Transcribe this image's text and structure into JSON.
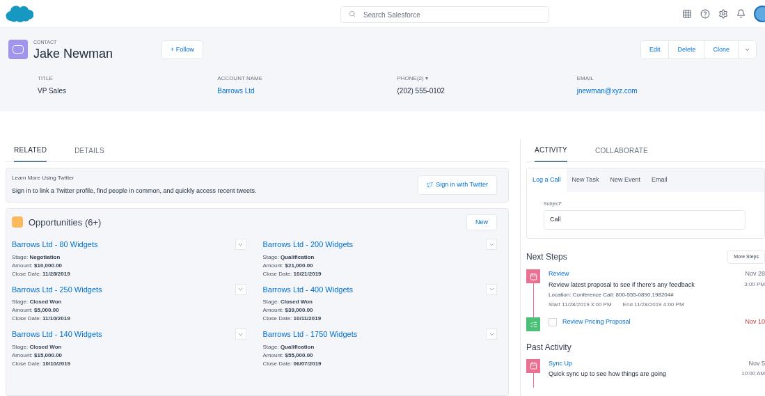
{
  "header": {
    "search": {
      "placeholder": "Search Salesforce"
    }
  },
  "record": {
    "type_label": "CONTACT",
    "name": "Jake Newman",
    "follow": "+ Follow",
    "actions": [
      "Edit",
      "Delete",
      "Clone"
    ],
    "fields": [
      {
        "label": "TITLE",
        "value": "VP Sales",
        "kind": "text"
      },
      {
        "label": "ACCOUNT NAME",
        "value": "Barrows Ltd",
        "kind": "link"
      },
      {
        "label": "PHONE(2) ▾",
        "value": "(202) 555-0102",
        "kind": "text"
      },
      {
        "label": "EMAIL",
        "value": "jnewman@xyz.com",
        "kind": "link"
      }
    ]
  },
  "left_tabs": [
    {
      "label": "RELATED",
      "selected": true
    },
    {
      "label": "DETAILS",
      "selected": false
    }
  ],
  "twitter": {
    "title": "Learn More Using Twitter",
    "text": "Sign in to link a Twitter profile, find people in common, and quickly access recent tweets.",
    "button": "Sign in with Twitter"
  },
  "opportunities": {
    "title": "Opportunities (6+)",
    "new_button": "New",
    "items": [
      {
        "name": "Barrows Ltd - 80 Widgets",
        "stage_label": "Stage:",
        "stage": "Negotiation",
        "amount_label": "Amount:",
        "amount": "$10,000.00",
        "close_label": "Close Date:",
        "close": "11/28/2019"
      },
      {
        "name": "Barrows Ltd - 200 Widgets",
        "stage_label": "Stage:",
        "stage": "Qualification",
        "amount_label": "Amount:",
        "amount": "$21,000.00",
        "close_label": "Close Date:",
        "close": "10/21/2019"
      },
      {
        "name": "Barrows Ltd - 250 Widgets",
        "stage_label": "Stage:",
        "stage": "Closed Won",
        "amount_label": "Amount:",
        "amount": "$5,000.00",
        "close_label": "Close Date:",
        "close": "11/10/2019"
      },
      {
        "name": "Barrows Ltd - 400 Widgets",
        "stage_label": "Stage:",
        "stage": "Closed Won",
        "amount_label": "Amount:",
        "amount": "$39,000.00",
        "close_label": "Close Date:",
        "close": "10/11/2019"
      },
      {
        "name": "Barrows Ltd - 140 Widgets",
        "stage_label": "Stage:",
        "stage": "Closed Won",
        "amount_label": "Amount:",
        "amount": "$15,000.00",
        "close_label": "Close Date:",
        "close": "10/10/2019"
      },
      {
        "name": "Barrows Ltd - 1750 Widgets",
        "stage_label": "Stage:",
        "stage": "Qualification",
        "amount_label": "Amount:",
        "amount": "$55,000.00",
        "close_label": "Close Date:",
        "close": "06/07/2019"
      }
    ]
  },
  "right_tabs": [
    {
      "label": "ACTIVITY",
      "selected": true
    },
    {
      "label": "COLLABORATE",
      "selected": false
    }
  ],
  "composer": {
    "tabs": [
      {
        "label": "Log a Call",
        "selected": true
      },
      {
        "label": "New Task",
        "selected": false
      },
      {
        "label": "New Event",
        "selected": false
      },
      {
        "label": "Email",
        "selected": false
      }
    ],
    "subject_label": "Subject*",
    "subject_value": "Call"
  },
  "next_steps": {
    "title": "Next Steps",
    "more_button": "More Steps",
    "items": [
      {
        "kind": "event",
        "title": "Review",
        "description": "Review latest proposal to see if there's any feedback",
        "location_label": "Location:",
        "location": "Conference Call: 800-555-0890,198204#",
        "start_label": "Start",
        "start": "11/28/2019 3:00 PM",
        "end_label": "End",
        "end": "11/28/2019 4:00 PM",
        "date": "Nov 28",
        "time": "3:00 PM",
        "overdue": false
      },
      {
        "kind": "task",
        "title": "Review Pricing Proposal",
        "checked": false,
        "date": "Nov 10",
        "overdue": true
      }
    ]
  },
  "past_activity": {
    "title": "Past Activity",
    "items": [
      {
        "kind": "event",
        "title": "Sync Up",
        "description": "Quick sync up to see how things are going",
        "date": "Nov 5",
        "time": "10:00 AM",
        "overdue": false
      }
    ]
  }
}
